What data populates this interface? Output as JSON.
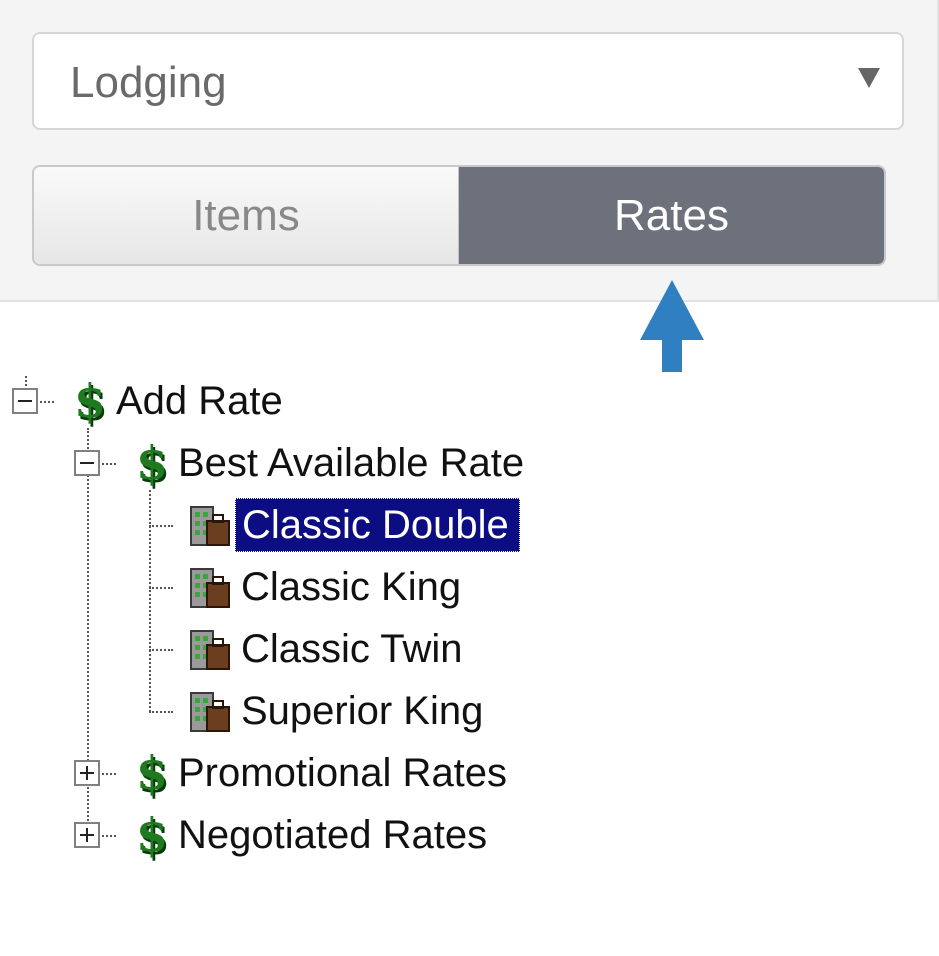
{
  "category_select": {
    "value": "Lodging"
  },
  "view_toggle": {
    "items_label": "Items",
    "rates_label": "Rates",
    "active": "Rates"
  },
  "tree": {
    "root": {
      "label": "Add Rate",
      "expanded": true
    },
    "groups": [
      {
        "label": "Best Available Rate",
        "expanded": true,
        "children": [
          "Classic Double",
          "Classic King",
          "Classic Twin",
          "Superior King"
        ],
        "selected": "Classic Double"
      },
      {
        "label": "Promotional Rates",
        "expanded": false
      },
      {
        "label": "Negotiated Rates",
        "expanded": false
      }
    ]
  },
  "colors": {
    "active_segment": "#6c717b",
    "selection": "#0c0c83",
    "arrow": "#2f7fc1",
    "dollar_icon": "#1f7a1f"
  },
  "icons": {
    "select_caret": "chevron-down-icon",
    "pointer_arrow": "arrow-up-icon",
    "collapse": "minus-box-icon",
    "expand": "plus-box-icon",
    "rate_group": "dollar-icon",
    "room_rate": "room-rate-icon"
  }
}
